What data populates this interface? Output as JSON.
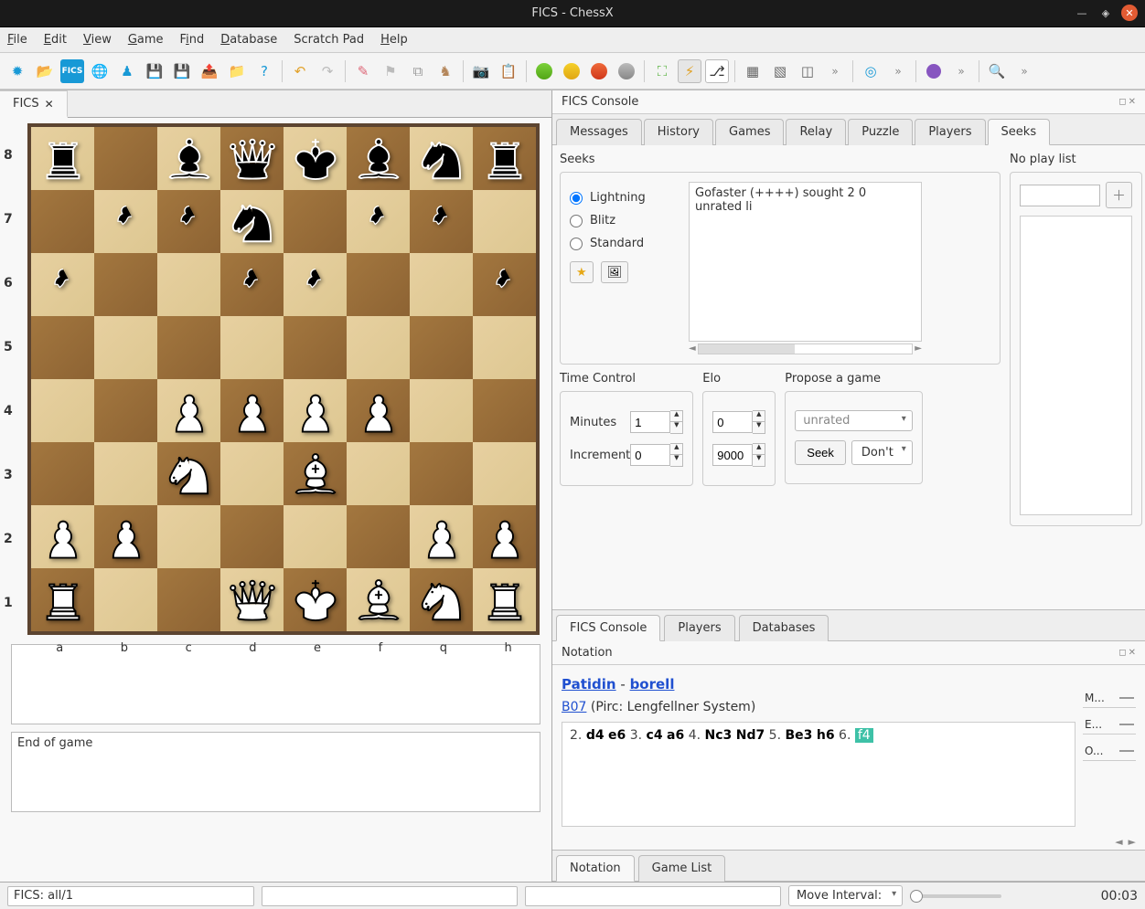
{
  "title": "FICS - ChessX",
  "menu": [
    "File",
    "Edit",
    "View",
    "Game",
    "Find",
    "Database",
    "Scratch Pad",
    "Help"
  ],
  "menuAccel": [
    0,
    0,
    0,
    0,
    1,
    0,
    -1,
    0
  ],
  "left": {
    "tab": "FICS",
    "ranks": [
      "8",
      "7",
      "6",
      "5",
      "4",
      "3",
      "2",
      "1"
    ],
    "files": [
      "a",
      "b",
      "c",
      "d",
      "e",
      "f",
      "q",
      "h"
    ],
    "eog": "End of game"
  },
  "board": {
    "position": [
      [
        "r",
        "",
        "b",
        "q",
        "k",
        "b",
        "n",
        "r"
      ],
      [
        "",
        "p",
        "p",
        "n",
        "",
        "p",
        "p",
        ""
      ],
      [
        "p",
        "",
        "",
        "p",
        "p",
        "",
        "",
        "p"
      ],
      [
        "",
        "",
        "",
        "",
        "",
        "",
        "",
        ""
      ],
      [
        "",
        "",
        "P",
        "P",
        "P",
        "P",
        "",
        ""
      ],
      [
        "",
        "",
        "N",
        "",
        "B",
        "",
        "",
        ""
      ],
      [
        "P",
        "P",
        "",
        "",
        "",
        "",
        "P",
        "P"
      ],
      [
        "R",
        "",
        "",
        "Q",
        "K",
        "B",
        "N",
        "R"
      ]
    ]
  },
  "fics": {
    "panelTitle": "FICS Console",
    "tabs": [
      "Messages",
      "History",
      "Games",
      "Relay",
      "Puzzle",
      "Players",
      "Seeks"
    ],
    "activeTab": "Seeks",
    "seeksLabel": "Seeks",
    "noPlayLabel": "No play list",
    "radios": [
      "Lightning",
      "Blitz",
      "Standard"
    ],
    "seekLog": "Gofaster (++++) sought 2 0 unrated li",
    "tc": {
      "label": "Time Control",
      "minLabel": "Minutes",
      "min": "1",
      "incLabel": "Increment",
      "inc": "0"
    },
    "elo": {
      "label": "Elo",
      "low": "0",
      "high": "9000"
    },
    "propose": {
      "label": "Propose a game",
      "type": "unrated",
      "seek": "Seek",
      "dont": "Don't"
    }
  },
  "lowerTabs": [
    "FICS Console",
    "Players",
    "Databases"
  ],
  "notation": {
    "title": "Notation",
    "white": "Patidin",
    "black": "borell",
    "eco": "B07",
    "opening": "(Pirc: Lengfellner System)",
    "moves": [
      {
        "n": "2.",
        "w": "d4",
        "b": "e6"
      },
      {
        "n": "3.",
        "w": "c4",
        "b": "a6"
      },
      {
        "n": "4.",
        "w": "Nc3",
        "b": "Nd7"
      },
      {
        "n": "5.",
        "w": "Be3",
        "b": "h6"
      },
      {
        "n": "6.",
        "w": "f4",
        "hl": true
      }
    ],
    "sliders": [
      "M...",
      "E...",
      "O..."
    ]
  },
  "notationTabs": [
    "Notation",
    "Game List"
  ],
  "status": {
    "left": "FICS: all/1",
    "interval": "Move Interval:",
    "time": "00:03"
  }
}
